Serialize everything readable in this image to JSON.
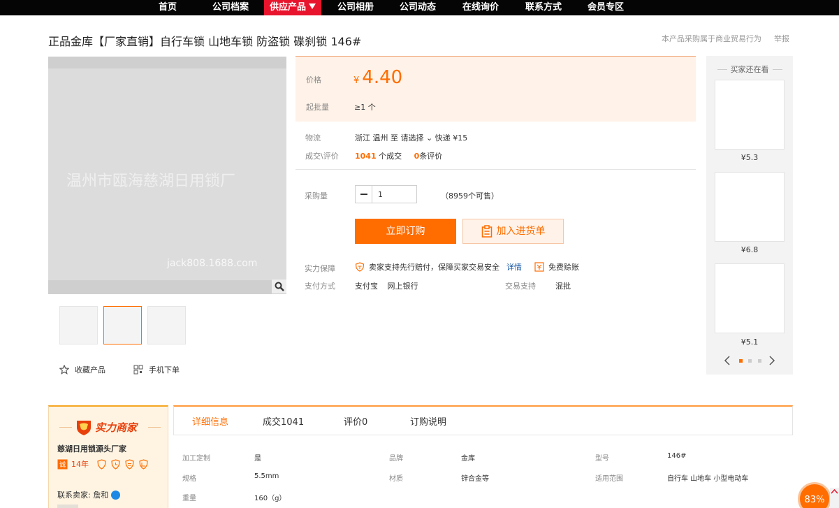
{
  "nav": {
    "items": [
      "首页",
      "公司档案",
      "供应产品",
      "公司相册",
      "公司动态",
      "在线询价",
      "联系方式",
      "会员专区"
    ],
    "active_index": 2,
    "active_color": "#e8142d"
  },
  "product": {
    "title": "正品金库【厂家直销】自行车锁 山地车锁 防盗锁 碟刹锁 146#",
    "purchase_note": "本产品采购属于商业贸易行为",
    "report_label": "举报",
    "watermark": "温州市瓯海慈湖日用锁厂",
    "watermark_url": "jack808.1688.com",
    "favorite_label": "收藏产品",
    "mobile_label": "手机下单"
  },
  "pricing": {
    "price_label": "价格",
    "currency": "¥",
    "price": "4.40",
    "moq_label": "起批量",
    "moq_value": "≥1 个",
    "accent": "#ff6d00"
  },
  "logistics": {
    "label": "物流",
    "value": "浙江 温州   至   请选择  ⌄     快递 ¥15"
  },
  "deals": {
    "label": "成交\\评价",
    "count": "1041",
    "count_suffix": "个成交",
    "reviews": "0",
    "reviews_suffix": "条评价"
  },
  "quantity": {
    "label": "采购量",
    "value": "1",
    "stock_note": "（8959个可售）"
  },
  "buttons": {
    "order": "立即订购",
    "cart": "加入进货单"
  },
  "guarantee": {
    "label": "实力保障",
    "text": "卖家支持先行赔付，保障买家交易安全",
    "detail_link": "详情",
    "free_return": "免费赊账"
  },
  "payment": {
    "label": "支付方式",
    "value": "支付宝 网上银行",
    "trade_label": "交易支持",
    "trade_value": "混批"
  },
  "recommendations": {
    "title": "买家还在看",
    "items": [
      {
        "price": "¥5.3"
      },
      {
        "price": "¥6.8"
      },
      {
        "price": "¥5.1"
      }
    ]
  },
  "seller": {
    "badge": "实力商家",
    "name": "慈湖日用锁源头厂家",
    "years": "14年",
    "contact": "联系卖家: 詹和"
  },
  "tabs": [
    "详细信息",
    "成交1041",
    "评价0",
    "订购说明"
  ],
  "attributes": [
    {
      "name": "加工定制",
      "value": "是"
    },
    {
      "name": "品牌",
      "value": "金库"
    },
    {
      "name": "型号",
      "value": "146#"
    },
    {
      "name": "规格",
      "value": "5.5mm"
    },
    {
      "name": "材质",
      "value": "锌合金等"
    },
    {
      "name": "适用范围",
      "value": "自行车 山地车 小型电动车"
    },
    {
      "name": "重量",
      "value": "160（g）"
    }
  ],
  "progress": {
    "percent_label": "83%"
  }
}
